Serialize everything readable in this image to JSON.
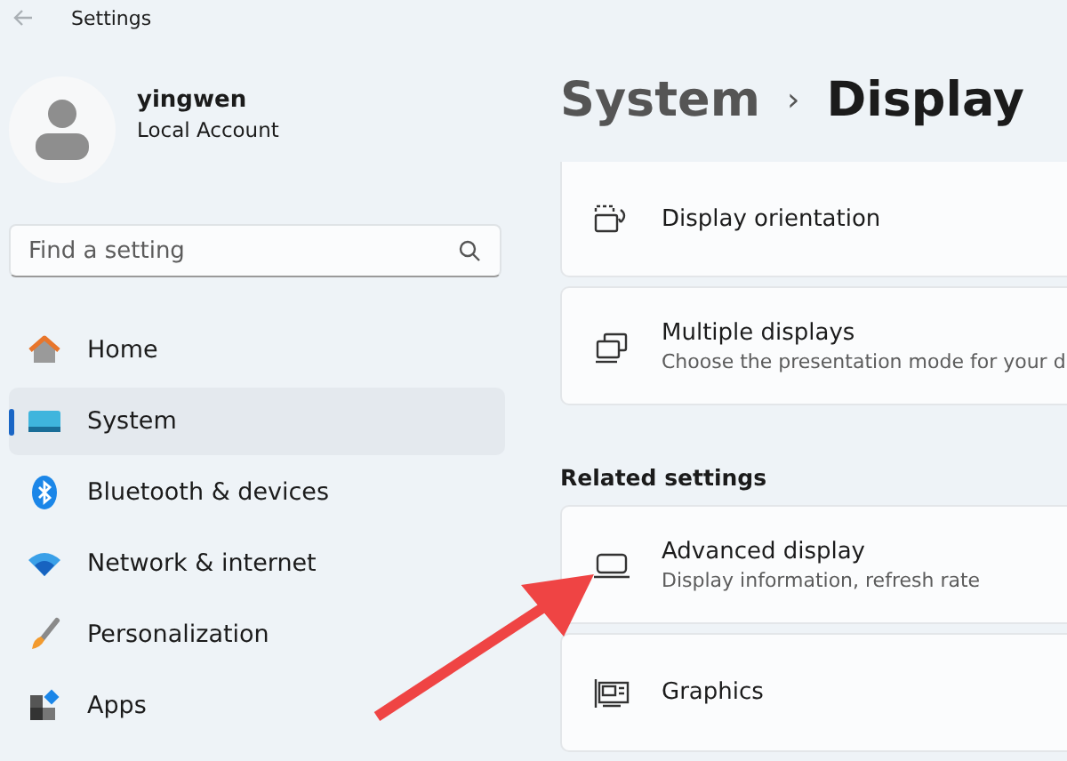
{
  "window": {
    "title": "Settings"
  },
  "account": {
    "name": "yingwen",
    "type": "Local Account"
  },
  "search": {
    "placeholder": "Find a setting"
  },
  "sidebar": {
    "items": [
      {
        "label": "Home",
        "kind": "home",
        "selected": false
      },
      {
        "label": "System",
        "kind": "system",
        "selected": true
      },
      {
        "label": "Bluetooth & devices",
        "kind": "bluetooth",
        "selected": false
      },
      {
        "label": "Network & internet",
        "kind": "network",
        "selected": false
      },
      {
        "label": "Personalization",
        "kind": "brush",
        "selected": false
      },
      {
        "label": "Apps",
        "kind": "apps",
        "selected": false
      }
    ]
  },
  "breadcrumb": {
    "parent": "System",
    "separator": "›",
    "current": "Display"
  },
  "cards": [
    {
      "title": "Display orientation",
      "kind": "orientation"
    },
    {
      "title": "Multiple displays",
      "subtitle": "Choose the presentation mode for your d",
      "kind": "multi"
    }
  ],
  "related": {
    "heading": "Related settings",
    "cards": [
      {
        "title": "Advanced display",
        "subtitle": "Display information, refresh rate",
        "kind": "monitor"
      },
      {
        "title": "Graphics",
        "kind": "graphics"
      }
    ]
  }
}
